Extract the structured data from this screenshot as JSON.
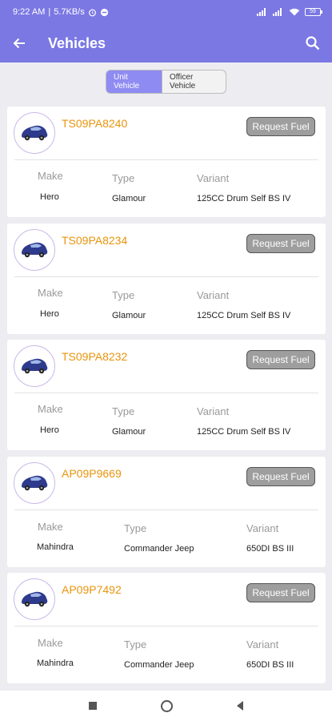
{
  "status_bar": {
    "time": "9:22 AM",
    "speed": "5.7KB/s",
    "battery": "59"
  },
  "header": {
    "title": "Vehicles"
  },
  "tabs": [
    {
      "label": "Unit Vehicle",
      "active": true
    },
    {
      "label": "Officer Vehicle",
      "active": false
    }
  ],
  "field_labels": {
    "make": "Make",
    "type": "Type",
    "variant": "Variant"
  },
  "vehicles": [
    {
      "reg_no": "TS09PA8240",
      "button": "Request Fuel",
      "make": "Hero",
      "type": "Glamour",
      "variant": "125CC Drum Self BS IV"
    },
    {
      "reg_no": "TS09PA8234",
      "button": "Request Fuel",
      "make": "Hero",
      "type": "Glamour",
      "variant": "125CC Drum Self BS IV"
    },
    {
      "reg_no": "TS09PA8232",
      "button": "Request Fuel",
      "make": "Hero",
      "type": "Glamour",
      "variant": "125CC Drum Self BS IV"
    },
    {
      "reg_no": "AP09P9669",
      "button": "Request Fuel",
      "make": "Mahindra",
      "type": "Commander Jeep",
      "variant": "650DI BS III"
    },
    {
      "reg_no": "AP09P7492",
      "button": "Request Fuel",
      "make": "Mahindra",
      "type": "Commander Jeep",
      "variant": "650DI BS III"
    }
  ],
  "colors": {
    "primary": "#7b78e3",
    "accent": "#e8940c",
    "tab_active": "#8e8bf2"
  }
}
